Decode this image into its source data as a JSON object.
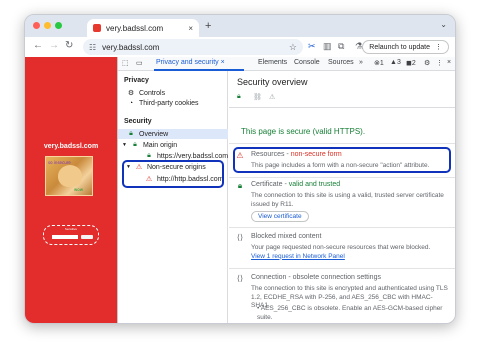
{
  "browser": {
    "tab_title": "very.badssl.com",
    "tab_close": "×",
    "new_tab": "+",
    "tab_menu": "⌄",
    "url": "very.badssl.com",
    "relaunch_label": "Relaunch to update",
    "relaunch_more": "⋮",
    "colors": {
      "close": "#ff5f57",
      "minimize": "#febc2e",
      "zoom": "#28c840"
    }
  },
  "page": {
    "site_title": "very.badssl.com",
    "meme_word_1": "so insecure",
    "meme_word_2": "wow",
    "form_label": "Sensitive",
    "background_color": "#e32c2c"
  },
  "devtools": {
    "panel_tabs": [
      "Privacy and security",
      "Elements",
      "Console",
      "Sources"
    ],
    "more_tabs": "»",
    "panel_close": "×",
    "error_count": "1",
    "warning_count": "3",
    "issue_count": "2",
    "sidebar": {
      "privacy_heading": "Privacy",
      "controls": "Controls",
      "third_party_cookies": "Third-party cookies",
      "security_heading": "Security",
      "overview": "Overview",
      "main_origin": "Main origin",
      "main_origin_url": "https://very.badssl.com",
      "non_secure_origins": "Non-secure origins",
      "non_secure_url": "http://http.badssl.com"
    },
    "overview": {
      "title": "Security overview",
      "page_secure": "This page is secure (valid HTTPS).",
      "resources_label": "Resources",
      "resources_status": "non-secure form",
      "resources_desc": "This page includes a form with a non-secure \"action\" attribute.",
      "certificate_label": "Certificate",
      "certificate_status": "valid and trusted",
      "certificate_desc": "The connection to this site is using a valid, trusted server certificate issued by R11.",
      "view_certificate": "View certificate",
      "mixed_title": "Blocked mixed content",
      "mixed_desc": "Your page requested non-secure resources that were blocked.",
      "mixed_link": "View 1 request in Network Panel",
      "connection_title": "Connection - obsolete connection settings",
      "connection_desc": "The connection to this site is encrypted and authenticated using TLS 1.2, ECDHE_RSA with P-256, and AES_256_CBC with HMAC-SHA1.",
      "connection_bullet": "AES_256_CBC is obsolete. Enable an AES-GCM-based cipher suite."
    }
  }
}
